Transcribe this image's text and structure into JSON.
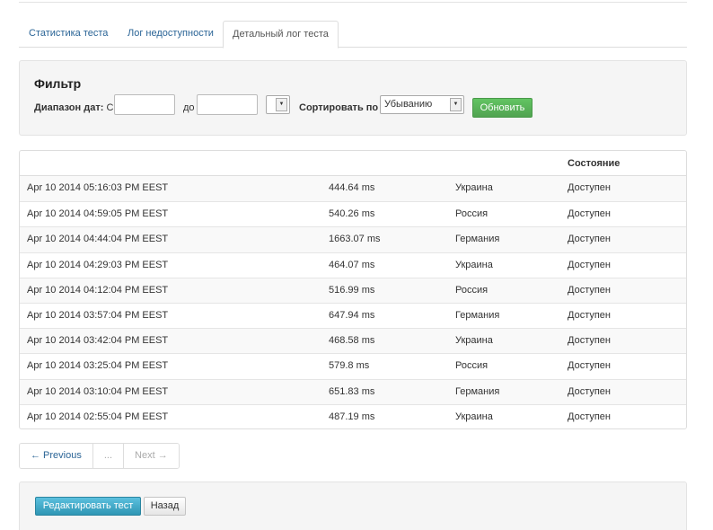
{
  "tabs": [
    {
      "label": "Статистика теста"
    },
    {
      "label": "Лог недоступности"
    },
    {
      "label": "Детальный лог теста"
    }
  ],
  "filter": {
    "title": "Фильтр",
    "date_range_label": "Диапазон дат:",
    "from_label": "С:",
    "to_label": "до",
    "from_value": "",
    "to_value": "",
    "sort_label": "Сортировать по :",
    "sort_value": "Убыванию",
    "refresh_label": "Обновить"
  },
  "table": {
    "columns": [
      "",
      "",
      "",
      "Состояние"
    ],
    "rows": [
      {
        "time": "Apr 10 2014 05:16:03 PM EEST",
        "response": "444.64 ms",
        "location": "Украина",
        "status": "Доступен"
      },
      {
        "time": "Apr 10 2014 04:59:05 PM EEST",
        "response": "540.26 ms",
        "location": "Россия",
        "status": "Доступен"
      },
      {
        "time": "Apr 10 2014 04:44:04 PM EEST",
        "response": "1663.07 ms",
        "location": "Германия",
        "status": "Доступен"
      },
      {
        "time": "Apr 10 2014 04:29:03 PM EEST",
        "response": "464.07 ms",
        "location": "Украина",
        "status": "Доступен"
      },
      {
        "time": "Apr 10 2014 04:12:04 PM EEST",
        "response": "516.99 ms",
        "location": "Россия",
        "status": "Доступен"
      },
      {
        "time": "Apr 10 2014 03:57:04 PM EEST",
        "response": "647.94 ms",
        "location": "Германия",
        "status": "Доступен"
      },
      {
        "time": "Apr 10 2014 03:42:04 PM EEST",
        "response": "468.58 ms",
        "location": "Украина",
        "status": "Доступен"
      },
      {
        "time": "Apr 10 2014 03:25:04 PM EEST",
        "response": "579.8 ms",
        "location": "Россия",
        "status": "Доступен"
      },
      {
        "time": "Apr 10 2014 03:10:04 PM EEST",
        "response": "651.83 ms",
        "location": "Германия",
        "status": "Доступен"
      },
      {
        "time": "Apr 10 2014 02:55:04 PM EEST",
        "response": "487.19 ms",
        "location": "Украина",
        "status": "Доступен"
      }
    ]
  },
  "pagination": {
    "previous": "← Previous",
    "ellipsis": "...",
    "next": "Next →"
  },
  "actions": {
    "edit_label": "Редактировать тест",
    "back_label": "Назад"
  },
  "colors": {
    "link": "#2a6496",
    "refresh_button": "#5cb85c",
    "edit_button": "#49afcd"
  }
}
